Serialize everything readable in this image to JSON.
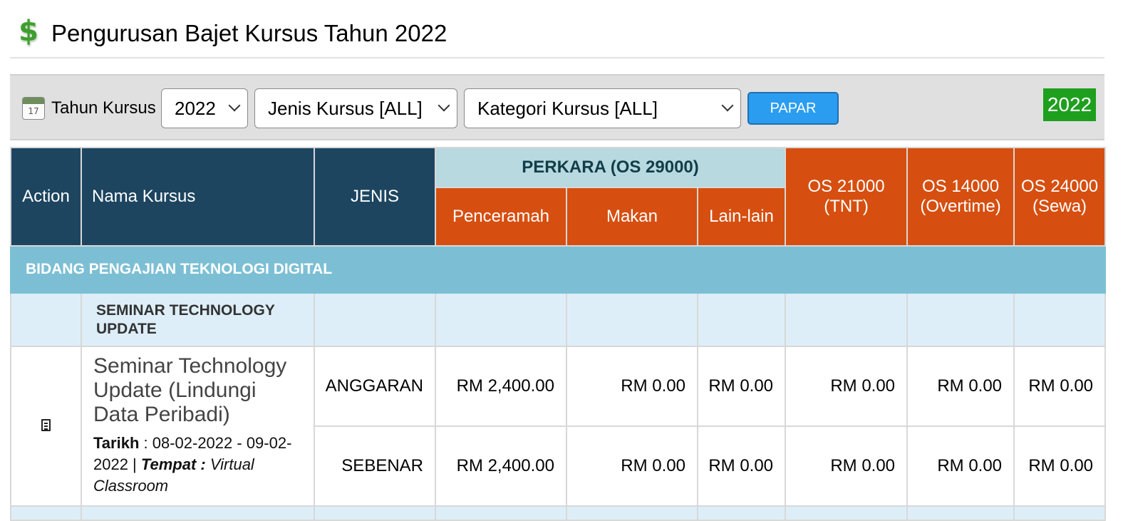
{
  "header": {
    "title": "Pengurusan Bajet Kursus Tahun 2022",
    "icon": "dollar-icon"
  },
  "filters": {
    "year_label": "Tahun Kursus",
    "calendar_day": "17",
    "year_value": "2022",
    "jenis_value": "Jenis Kursus [ALL]",
    "kategori_value": "Kategori Kursus [ALL]",
    "button_label": "PAPAR",
    "year_badge": "2022"
  },
  "table": {
    "headers": {
      "action": "Action",
      "nama_kursus": "Nama Kursus",
      "jenis": "JENIS",
      "perkara": "PERKARA (OS 29000)",
      "penceramah": "Penceramah",
      "makan": "Makan",
      "lain_lain": "Lain-lain",
      "os21000": "OS 21000 (TNT)",
      "os14000": "OS 14000 (Overtime)",
      "os24000": "OS 24000 (Sewa)"
    },
    "group": "BIDANG PENGAJIAN TEKNOLOGI DIGITAL",
    "subgroup": "SEMINAR TECHNOLOGY UPDATE",
    "course": {
      "name": "Seminar Technology Update (Lindungi Data Peribadi)",
      "tarikh_label": "Tarikh",
      "tarikh_value": " : 08-02-2022 - 09-02-2022 | ",
      "tempat_label": "Tempat :",
      "tempat_value": " Virtual Classroom"
    },
    "rows": [
      {
        "jenis": "ANGGARAN",
        "penceramah": "RM 2,400.00",
        "makan": "RM 0.00",
        "lain_lain": "RM 0.00",
        "os21000": "RM 0.00",
        "os14000": "RM 0.00",
        "os24000": "RM 0.00"
      },
      {
        "jenis": "SEBENAR",
        "penceramah": "RM 2,400.00",
        "makan": "RM 0.00",
        "lain_lain": "RM 0.00",
        "os21000": "RM 0.00",
        "os14000": "RM 0.00",
        "os24000": "RM 0.00"
      }
    ]
  },
  "colors": {
    "header_dark": "#1d4560",
    "header_orange": "#d64f10",
    "header_teal": "#b7d9df",
    "group_row": "#7cbfd4",
    "sub_row": "#ddeef8",
    "button": "#2b9df0",
    "badge": "#1ea01e"
  }
}
